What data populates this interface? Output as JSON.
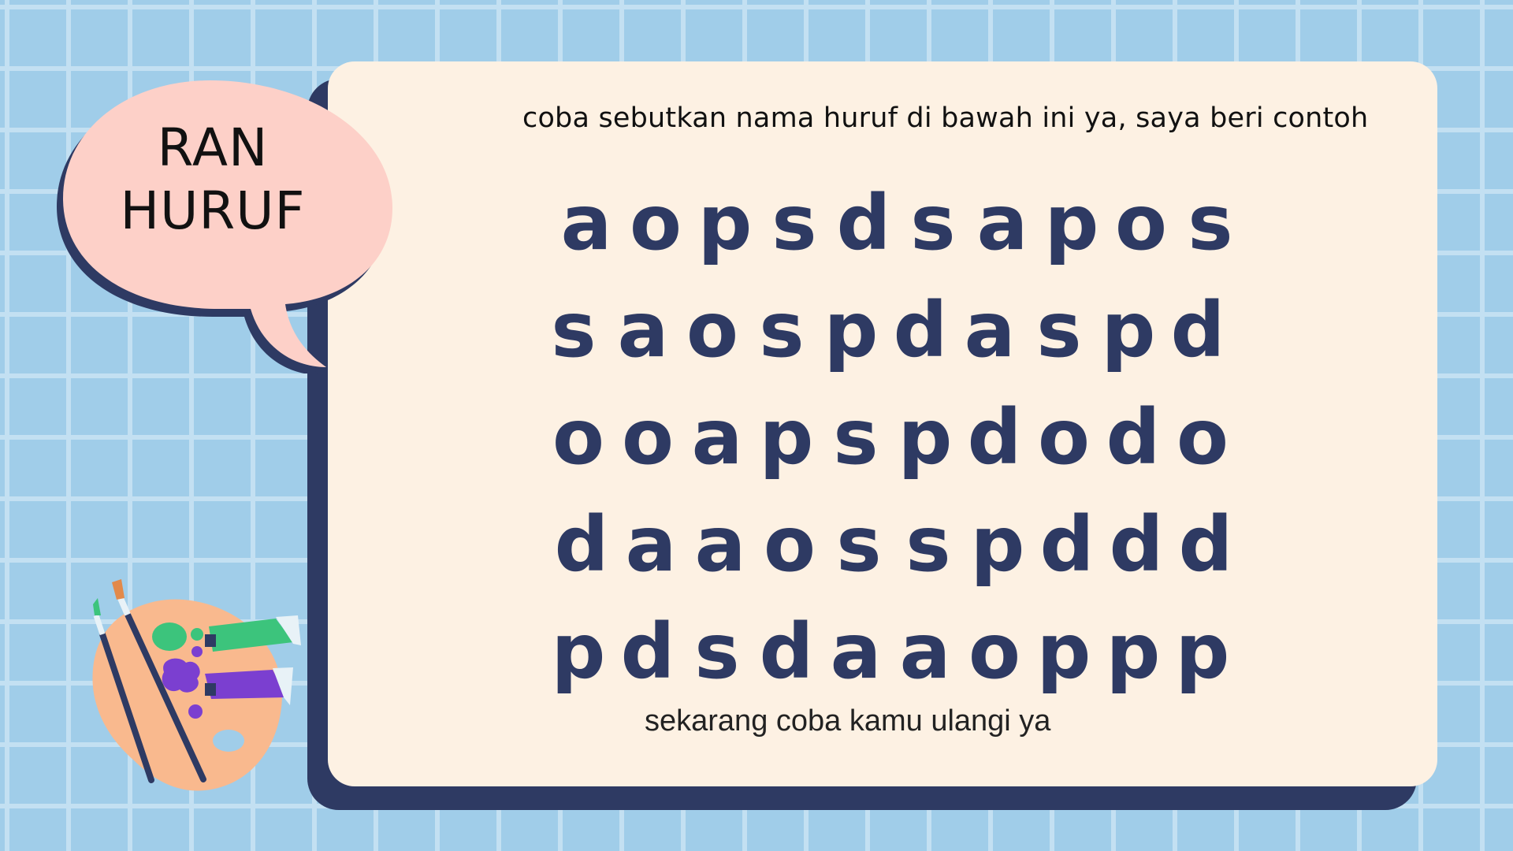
{
  "bubble": {
    "line1": "RAN",
    "line2": "HURUF"
  },
  "instruction": "coba sebutkan nama huruf di bawah ini ya, saya beri contoh",
  "rows": [
    [
      "a",
      "o",
      "p",
      "s",
      "d",
      "s",
      "a",
      "p",
      "o",
      "s"
    ],
    [
      "s",
      "a",
      "o",
      "s",
      "p",
      "d",
      "a",
      "s",
      "p",
      "d"
    ],
    [
      "o",
      "o",
      "a",
      "p",
      "s",
      "p",
      "d",
      "o",
      "d",
      "o"
    ],
    [
      "d",
      "a",
      "a",
      "o",
      "s",
      "s",
      "p",
      "d",
      "d",
      "d"
    ],
    [
      "p",
      "d",
      "s",
      "d",
      "a",
      "a",
      "o",
      "p",
      "p",
      "p"
    ]
  ],
  "footer": "sekarang coba kamu ulangi ya",
  "colors": {
    "background": "#a0cde9",
    "grid_lines": "#c3e0f2",
    "card": "#fdf1e3",
    "card_shadow": "#2e3a63",
    "letters": "#2e3a63",
    "bubble_fill": "#fdd0c8",
    "palette": "#f9b98e"
  },
  "icons": {
    "bubble": "speech-bubble-icon",
    "palette": "paint-palette-icon"
  }
}
